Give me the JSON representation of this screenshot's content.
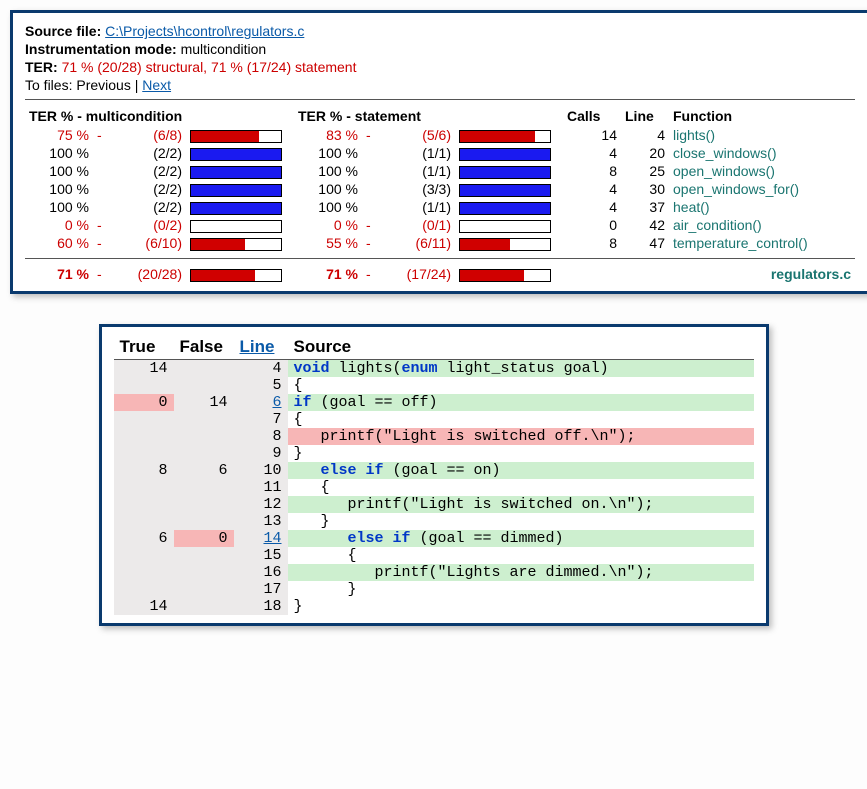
{
  "header": {
    "source_label": "Source file:",
    "source_path": "C:\\Projects\\hcontrol\\regulators.c",
    "mode_label": "Instrumentation mode:",
    "mode_value": "multicondition",
    "ter_label": "TER:",
    "ter_value": "71 % (20/28) structural, 71 % (17/24) statement",
    "tofiles_label": "To files:",
    "prev": "Previous",
    "sep": " | ",
    "next": "Next"
  },
  "cols": {
    "mc": "TER % - multicondition",
    "st": "TER % - statement",
    "calls": "Calls",
    "line": "Line",
    "fn": "Function"
  },
  "rows": [
    {
      "mc_pct": "75 %",
      "mc_flag": "-",
      "mc_ratio": "(6/8)",
      "mc_fill": 75,
      "mc_color": "red",
      "st_pct": "83 %",
      "st_flag": "-",
      "st_ratio": "(5/6)",
      "st_fill": 83,
      "st_color": "red",
      "calls": "14",
      "line": "4",
      "fn": "lights()",
      "bad": true
    },
    {
      "mc_pct": "100 %",
      "mc_flag": "",
      "mc_ratio": "(2/2)",
      "mc_fill": 100,
      "mc_color": "blue",
      "st_pct": "100 %",
      "st_flag": "",
      "st_ratio": "(1/1)",
      "st_fill": 100,
      "st_color": "blue",
      "calls": "4",
      "line": "20",
      "fn": "close_windows()",
      "bad": false
    },
    {
      "mc_pct": "100 %",
      "mc_flag": "",
      "mc_ratio": "(2/2)",
      "mc_fill": 100,
      "mc_color": "blue",
      "st_pct": "100 %",
      "st_flag": "",
      "st_ratio": "(1/1)",
      "st_fill": 100,
      "st_color": "blue",
      "calls": "8",
      "line": "25",
      "fn": "open_windows()",
      "bad": false
    },
    {
      "mc_pct": "100 %",
      "mc_flag": "",
      "mc_ratio": "(2/2)",
      "mc_fill": 100,
      "mc_color": "blue",
      "st_pct": "100 %",
      "st_flag": "",
      "st_ratio": "(3/3)",
      "st_fill": 100,
      "st_color": "blue",
      "calls": "4",
      "line": "30",
      "fn": "open_windows_for()",
      "bad": false
    },
    {
      "mc_pct": "100 %",
      "mc_flag": "",
      "mc_ratio": "(2/2)",
      "mc_fill": 100,
      "mc_color": "blue",
      "st_pct": "100 %",
      "st_flag": "",
      "st_ratio": "(1/1)",
      "st_fill": 100,
      "st_color": "blue",
      "calls": "4",
      "line": "37",
      "fn": "heat()",
      "bad": false
    },
    {
      "mc_pct": "0 %",
      "mc_flag": "-",
      "mc_ratio": "(0/2)",
      "mc_fill": 0,
      "mc_color": "red",
      "st_pct": "0 %",
      "st_flag": "-",
      "st_ratio": "(0/1)",
      "st_fill": 0,
      "st_color": "red",
      "calls": "0",
      "line": "42",
      "fn": "air_condition()",
      "bad": true
    },
    {
      "mc_pct": "60 %",
      "mc_flag": "-",
      "mc_ratio": "(6/10)",
      "mc_fill": 60,
      "mc_color": "red",
      "st_pct": "55 %",
      "st_flag": "-",
      "st_ratio": "(6/11)",
      "st_fill": 55,
      "st_color": "red",
      "calls": "8",
      "line": "47",
      "fn": "temperature_control()",
      "bad": true
    }
  ],
  "totals": {
    "mc_pct": "71 %",
    "mc_flag": "-",
    "mc_ratio": "(20/28)",
    "mc_fill": 71,
    "st_pct": "71 %",
    "st_flag": "-",
    "st_ratio": "(17/24)",
    "st_fill": 71,
    "file": "regulators.c"
  },
  "src_cols": {
    "t": "True",
    "f": "False",
    "l": "Line",
    "s": "Source"
  },
  "src": [
    {
      "t": "14",
      "f": "",
      "tbad": false,
      "fbad": false,
      "ln": "4",
      "link": false,
      "html": "<span class='kw'>void</span> lights(<span class='kw'>enum</span> light_status goal)",
      "cov": "cov"
    },
    {
      "t": "",
      "f": "",
      "tbad": false,
      "fbad": false,
      "ln": "5",
      "link": false,
      "html": "{",
      "cov": ""
    },
    {
      "t": "0",
      "f": "14",
      "tbad": true,
      "fbad": false,
      "ln": "6",
      "link": true,
      "html": "<span class='kw'>if</span> (goal == off)",
      "cov": "cov"
    },
    {
      "t": "",
      "f": "",
      "tbad": false,
      "fbad": false,
      "ln": "7",
      "link": false,
      "html": "{",
      "cov": ""
    },
    {
      "t": "",
      "f": "",
      "tbad": false,
      "fbad": false,
      "ln": "8",
      "link": false,
      "html": "   printf(\"Light is switched off.\\n\");",
      "cov": "uncov"
    },
    {
      "t": "",
      "f": "",
      "tbad": false,
      "fbad": false,
      "ln": "9",
      "link": false,
      "html": "}",
      "cov": ""
    },
    {
      "t": "8",
      "f": "6",
      "tbad": false,
      "fbad": false,
      "ln": "10",
      "link": false,
      "html": "   <span class='kw'>else if</span> (goal == on)",
      "cov": "cov"
    },
    {
      "t": "",
      "f": "",
      "tbad": false,
      "fbad": false,
      "ln": "11",
      "link": false,
      "html": "   {",
      "cov": ""
    },
    {
      "t": "",
      "f": "",
      "tbad": false,
      "fbad": false,
      "ln": "12",
      "link": false,
      "html": "      printf(\"Light is switched on.\\n\");",
      "cov": "cov"
    },
    {
      "t": "",
      "f": "",
      "tbad": false,
      "fbad": false,
      "ln": "13",
      "link": false,
      "html": "   }",
      "cov": ""
    },
    {
      "t": "6",
      "f": "0",
      "tbad": false,
      "fbad": true,
      "ln": "14",
      "link": true,
      "html": "      <span class='kw'>else if</span> (goal == dimmed)",
      "cov": "cov"
    },
    {
      "t": "",
      "f": "",
      "tbad": false,
      "fbad": false,
      "ln": "15",
      "link": false,
      "html": "      {",
      "cov": ""
    },
    {
      "t": "",
      "f": "",
      "tbad": false,
      "fbad": false,
      "ln": "16",
      "link": false,
      "html": "         printf(\"Lights are dimmed.\\n\");",
      "cov": "cov"
    },
    {
      "t": "",
      "f": "",
      "tbad": false,
      "fbad": false,
      "ln": "17",
      "link": false,
      "html": "      }",
      "cov": ""
    },
    {
      "t": "14",
      "f": "",
      "tbad": false,
      "fbad": false,
      "ln": "18",
      "link": false,
      "html": "}",
      "cov": ""
    }
  ]
}
